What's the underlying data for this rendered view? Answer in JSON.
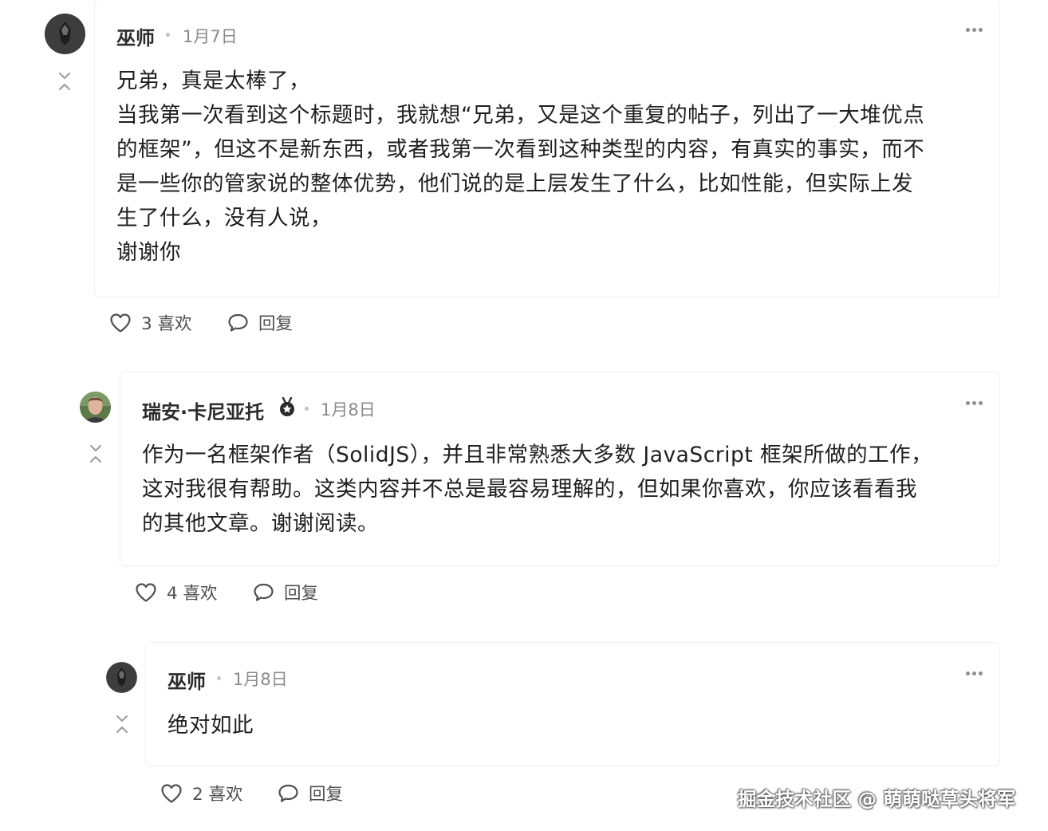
{
  "comments": [
    {
      "author": "巫师",
      "date": "1月7日",
      "lines": [
        "兄弟，真是太棒了，",
        "当我第一次看到这个标题时，我就想“兄弟，又是这个重复的帖子，列出了一大堆优点",
        "的框架”，但这不是新东西，或者我第一次看到这种类型的内容，有真实的事实，而不",
        "是一些你的管家说的整体优势，他们说的是上层发生了什么，比如性能，但实际上发",
        "生了什么，没有人说，",
        "谢谢你"
      ],
      "likes": "3 喜欢",
      "reply": "回复"
    },
    {
      "author": "瑞安·卡尼亚托",
      "date": "1月8日",
      "badge_icon": "medal-icon",
      "lines": [
        "作为一名框架作者（SolidJS），并且非常熟悉大多数 JavaScript 框架所做的工作，",
        "这对我很有帮助。这类内容并不总是最容易理解的，但如果你喜欢，你应该看看我",
        "的其他文章。谢谢阅读。"
      ],
      "likes": "4 喜欢",
      "reply": "回复"
    },
    {
      "author": "巫师",
      "date": "1月8日",
      "lines": [
        "绝对如此"
      ],
      "likes": "2 喜欢",
      "reply": "回复"
    }
  ],
  "watermark": "掘金技术社区 @ 萌萌哒草头将军",
  "icons": {
    "like": "heart-icon",
    "reply": "speech-bubble-icon",
    "collapse": "collapse-arrows-icon",
    "more": "more-options-icon"
  },
  "colors": {
    "text": "#1f1f1f",
    "meta": "#8a8a8a",
    "action": "#4f4f4f"
  }
}
